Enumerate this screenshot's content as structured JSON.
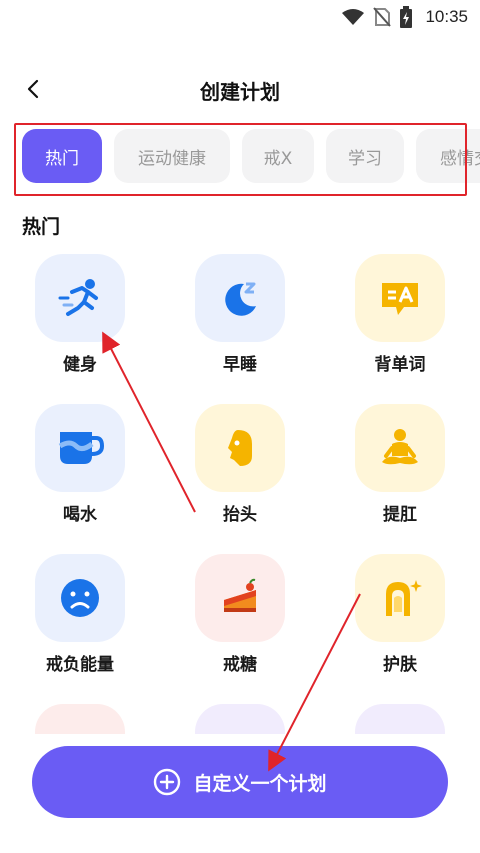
{
  "status_bar": {
    "time": "10:35",
    "icons": [
      "wifi-icon",
      "no-sim-icon",
      "battery-charging-icon"
    ]
  },
  "header": {
    "title": "创建计划",
    "back_icon": "chevron-left-icon"
  },
  "tabs": [
    {
      "label": "热门",
      "active": true
    },
    {
      "label": "运动健康",
      "active": false
    },
    {
      "label": "戒X",
      "active": false
    },
    {
      "label": "学习",
      "active": false
    },
    {
      "label": "感情交流",
      "active": false
    }
  ],
  "section": {
    "title": "热门"
  },
  "items": [
    {
      "label": "健身",
      "icon": "running-person-icon"
    },
    {
      "label": "早睡",
      "icon": "moon-sleep-icon"
    },
    {
      "label": "背单词",
      "icon": "translate-icon"
    },
    {
      "label": "喝水",
      "icon": "cup-icon"
    },
    {
      "label": "抬头",
      "icon": "head-up-icon"
    },
    {
      "label": "提肛",
      "icon": "meditation-icon"
    },
    {
      "label": "戒负能量",
      "icon": "sad-face-icon"
    },
    {
      "label": "戒糖",
      "icon": "cake-icon"
    },
    {
      "label": "护肤",
      "icon": "skincare-icon"
    }
  ],
  "custom_button": {
    "label": "自定义一个计划",
    "icon": "plus-circle-icon"
  },
  "colors": {
    "accent": "#6a5cf4",
    "highlight": "#e0242b",
    "icon_blue": "#1a73e8",
    "icon_yellow": "#f5b400"
  }
}
